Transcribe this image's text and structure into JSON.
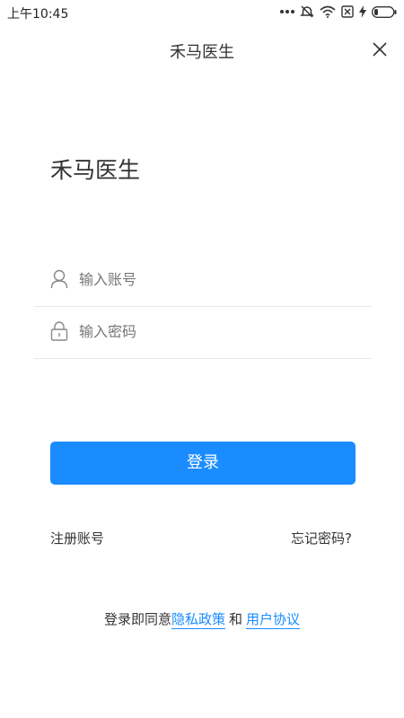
{
  "status_bar": {
    "time": "上午10:45"
  },
  "nav": {
    "title": "禾马医生",
    "close_icon": "close-icon"
  },
  "brand": {
    "title": "禾马医生"
  },
  "form": {
    "account_placeholder": "输入账号",
    "account_value": "",
    "account_icon": "user-icon",
    "password_placeholder": "输入密码",
    "password_value": "",
    "password_icon": "lock-icon"
  },
  "login_button": {
    "label": "登录"
  },
  "links": {
    "register": "注册账号",
    "forgot": "忘记密码?"
  },
  "agreement": {
    "prefix": "登录即同意",
    "privacy": "隐私政策",
    "and": "和",
    "terms": "用户协议"
  },
  "colors": {
    "accent": "#1a8cff",
    "text": "#333333",
    "divider": "#e8e8e8"
  }
}
